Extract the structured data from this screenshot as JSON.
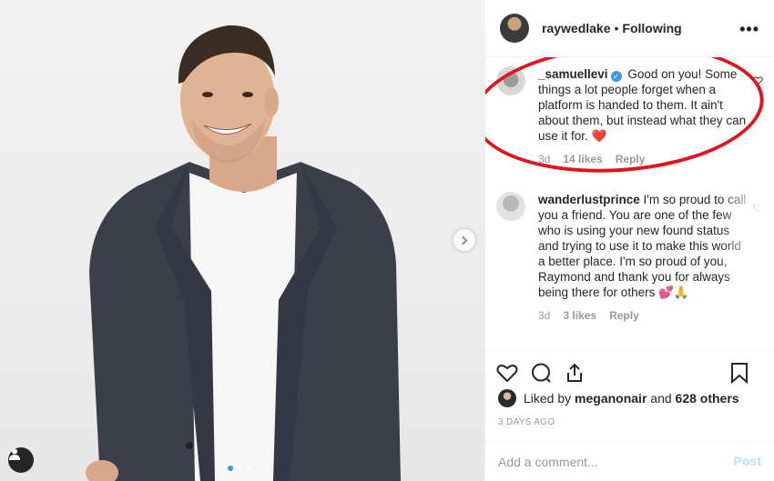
{
  "header": {
    "username": "raywedlake",
    "separator": "•",
    "follow_state": "Following",
    "more": "•••"
  },
  "comments": [
    {
      "username": "_samuellevi",
      "verified": true,
      "text": "Good on you! Some things a lot people forget when a platform is handed to them. It ain't about them, but instead what they can use it for. ❤️",
      "age": "3d",
      "likes": "14 likes",
      "reply": "Reply"
    },
    {
      "username": "wanderlustprince",
      "verified": false,
      "text": "I'm so proud to call you a friend. You are one of the few who is using your new found status and trying to use it to make this world a better place. I'm so proud of you, Raymond and thank you for always being there for others 💕🙏",
      "age": "3d",
      "likes": "3 likes",
      "reply": "Reply"
    }
  ],
  "likes": {
    "prefix": "Liked by",
    "user": "meganonair",
    "and": "and",
    "others": "628 others"
  },
  "timestamp": "3 DAYS AGO",
  "composer": {
    "placeholder": "Add a comment...",
    "post_label": "Post"
  },
  "colors": {
    "accent": "#3897f0",
    "highlight_ring": "#e0141e",
    "post_disabled": "#b2dffc"
  }
}
